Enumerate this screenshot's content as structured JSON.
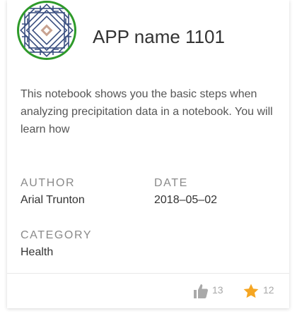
{
  "app": {
    "name": "APP name 1101",
    "description": "This notebook shows you the basic steps when analyzing precipitation data in a notebook. You will learn how"
  },
  "meta": {
    "author_label": "AUTHOR",
    "author": "Arial Trunton",
    "date_label": "DATE",
    "date": "2018–05–02",
    "category_label": "CATEGORY",
    "category": "Health"
  },
  "stats": {
    "likes": "13",
    "stars": "12"
  },
  "colors": {
    "logo_ring": "#2e9a2a",
    "logo_pattern": "#3a4f80",
    "logo_center": "#c9a391",
    "like_icon": "#a9a9a9",
    "star_icon": "#f5a623"
  },
  "icons": {
    "like": "thumbs-up-icon",
    "star": "star-icon"
  }
}
